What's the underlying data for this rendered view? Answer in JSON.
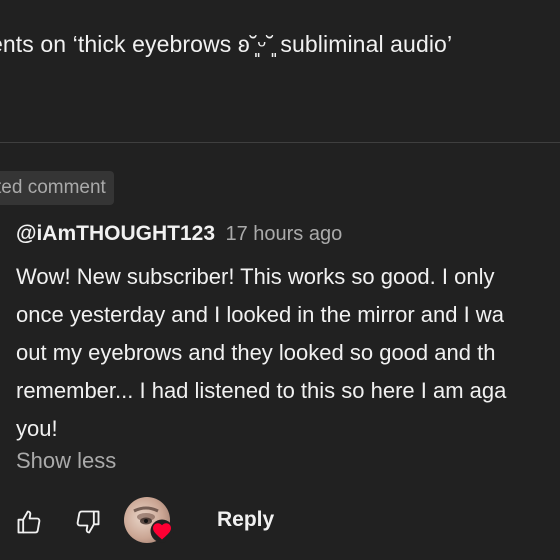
{
  "header": {
    "title": "ents on ‘thick eyebrows ʚ˘͈ᵕ˘͈ subliminal audio’"
  },
  "highlighted_badge": "ted comment",
  "comment": {
    "author": "@iAmTHOUGHT123",
    "timestamp": "17 hours ago",
    "text_lines": [
      "Wow! New subscriber! This works so good. I only",
      "once yesterday and I looked in the mirror and I wa",
      "out my eyebrows and they looked so good and th",
      "remember... I had listened to this so here I am aga",
      "you!"
    ],
    "show_less_label": "Show less",
    "reply_label": "Reply"
  },
  "icons": {
    "like": "thumbs-up-icon",
    "dislike": "thumbs-down-icon",
    "creator_heart": "heart-icon"
  },
  "colors": {
    "background": "#212121",
    "text_primary": "#f1f1f1",
    "text_secondary": "#aaaaaa",
    "heart": "#ff0033"
  }
}
